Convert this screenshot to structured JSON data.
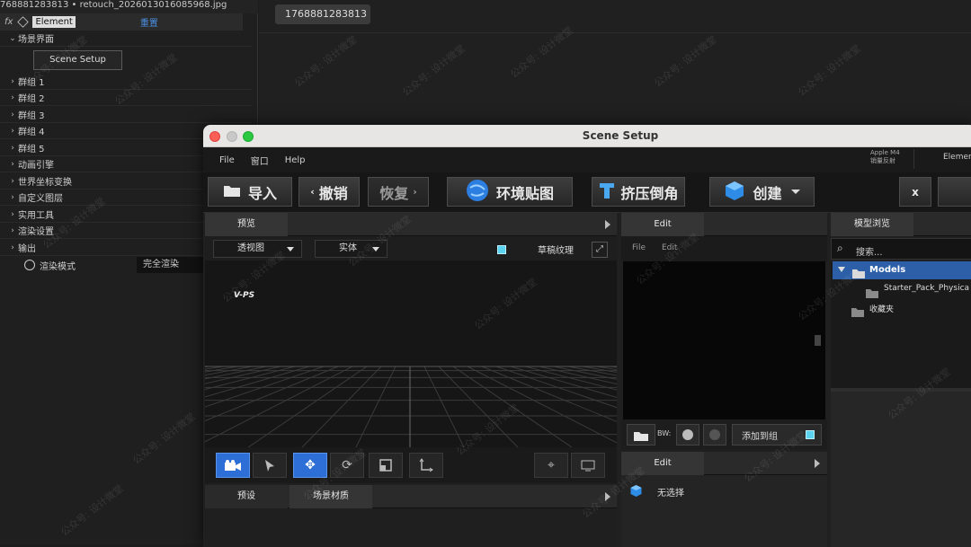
{
  "host": {
    "file_bar": "768881283813 • retouch_20260130160859​68.jpg",
    "layer": {
      "fx": "fx",
      "name": "Element",
      "reset": "重置"
    },
    "scene_group": "场景界面",
    "scene_setup_button": "Scene Setup",
    "tree_items": [
      "群组 1",
      "群组 2",
      "群组 3",
      "群组 4",
      "群组 5",
      "动画引擎",
      "世界坐标变换",
      "自定义图层",
      "实用工具",
      "渲染设置",
      "输出"
    ],
    "render_mode_label": "渲染模式",
    "render_mode_value": "完全渲染",
    "top_tag": "1768881283813"
  },
  "window": {
    "title": "Scene Setup",
    "menu": [
      "File",
      "窗口",
      "Help"
    ],
    "gpu_line1": "Apple M4",
    "gpu_line2": "销量反射",
    "element_label": "Elemen",
    "toolbar": {
      "import": "导入",
      "undo": "撤销",
      "redo": "恢复",
      "env_map": "环境贴图",
      "extrude": "挤压倒角",
      "create": "创建",
      "close": "x"
    },
    "preview_panel": {
      "tab": "预览",
      "camera_dropdown": "透视图",
      "mode_dropdown": "实体",
      "draft_texture": "草稿纹理",
      "viewport_label": "V-PS"
    },
    "edit_panel": {
      "tab": "Edit",
      "menu_file": "File",
      "menu_edit": "Edit",
      "bw_label": "BW:",
      "add_group": "添加到组"
    },
    "edit_panel2": {
      "tab": "Edit",
      "no_selection": "无选择"
    },
    "bottom_tabs": [
      "预设",
      "场景材质"
    ],
    "model_browser": {
      "tab": "模型浏览",
      "search_placeholder": "搜索...",
      "items": [
        {
          "name": "Models",
          "selected": true
        },
        {
          "name": "Starter_Pack_Physica",
          "selected": false
        },
        {
          "name": "收藏夹",
          "selected": false
        }
      ]
    }
  },
  "watermark": "公众号: 设计微堂",
  "colors": {
    "accent": "#2d6fd6",
    "cyan": "#5ad2f0",
    "link": "#4a8fe3"
  }
}
